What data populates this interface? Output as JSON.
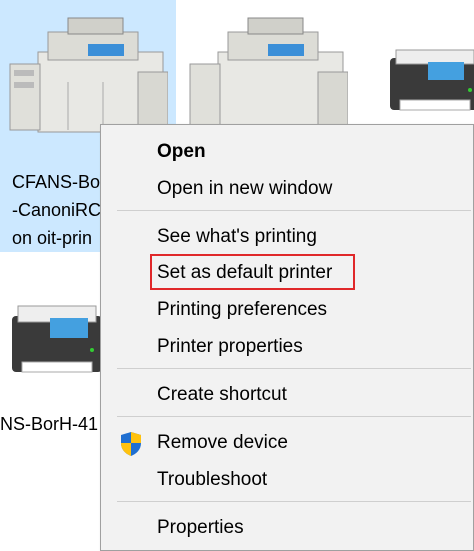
{
  "background_printers": [
    {
      "label_lines": [
        "CFANS-Bo",
        "-CanoniRC",
        "on oit-prin"
      ],
      "selected": true
    },
    {
      "label_lines": [],
      "selected": false
    },
    {
      "label_lines": [],
      "selected": false
    },
    {
      "label_lines": [
        "NS-BorH-41"
      ],
      "selected": false
    }
  ],
  "context_menu": {
    "items": [
      {
        "label": "Open"
      },
      {
        "label": "Open in new window"
      },
      {
        "label": "See what's printing"
      },
      {
        "label": "Set as default printer"
      },
      {
        "label": "Printing preferences"
      },
      {
        "label": "Printer properties"
      },
      {
        "label": "Create shortcut"
      },
      {
        "label": "Remove device",
        "icon": "uac-shield-icon"
      },
      {
        "label": "Troubleshoot"
      },
      {
        "label": "Properties"
      }
    ],
    "highlighted_item": "Set as default printer",
    "highlight_color": "#e0282a"
  },
  "colors": {
    "selection": "#cce8ff",
    "menu_background": "#f2f2f2",
    "shield_blue": "#1f6fd1",
    "shield_yellow": "#ffc20e"
  }
}
